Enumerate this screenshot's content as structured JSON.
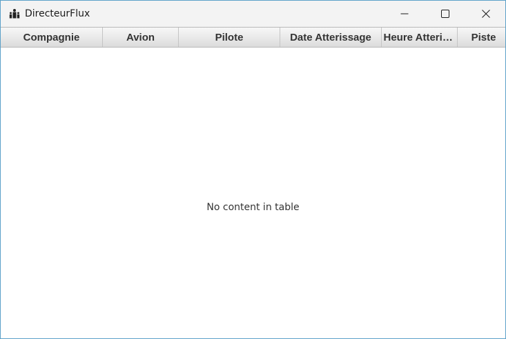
{
  "window": {
    "title": "DirecteurFlux",
    "app_icon": "group-of-people-icon",
    "controls": {
      "minimize_icon": "minimize-icon",
      "maximize_icon": "maximize-icon",
      "close_icon": "close-icon"
    }
  },
  "table": {
    "columns": [
      "Compagnie",
      "Avion",
      "Pilote",
      "Date Atterissage",
      "Heure Atterissage",
      "Piste"
    ],
    "rows": [],
    "placeholder": "No content in table"
  },
  "colors": {
    "window_border": "#5aa0c8",
    "titlebar": "#f3f3f3",
    "header_top": "#f7f7f7",
    "header_bottom": "#dcdcdc"
  }
}
